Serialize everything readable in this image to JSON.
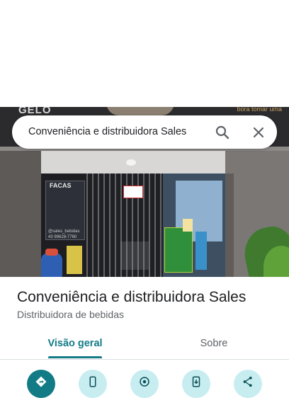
{
  "search": {
    "query": "Conveniência e distribuidora Sales",
    "search_icon": "search-icon",
    "close_icon": "close-icon"
  },
  "photo": {
    "sign_word": "GELO",
    "sign_right": "bora tomar uma",
    "poster_title": "FACAS",
    "poster_handle": "@sales_bebidas",
    "poster_phone": "43 99628-7760"
  },
  "place": {
    "name": "Conveniência e distribuidora Sales",
    "category": "Distribuidora de bebidas"
  },
  "tabs": [
    {
      "label": "Visão geral",
      "selected": true
    },
    {
      "label": "Sobre",
      "selected": false
    }
  ],
  "actions": [
    {
      "icon": "directions-icon"
    },
    {
      "icon": "phone-icon"
    },
    {
      "icon": "nearby-icon"
    },
    {
      "icon": "send-to-phone-icon"
    },
    {
      "icon": "share-icon"
    }
  ],
  "colors": {
    "accent": "#137b86",
    "action_bg": "#c7edf1",
    "text_primary": "#202124",
    "text_secondary": "#5f6368"
  }
}
